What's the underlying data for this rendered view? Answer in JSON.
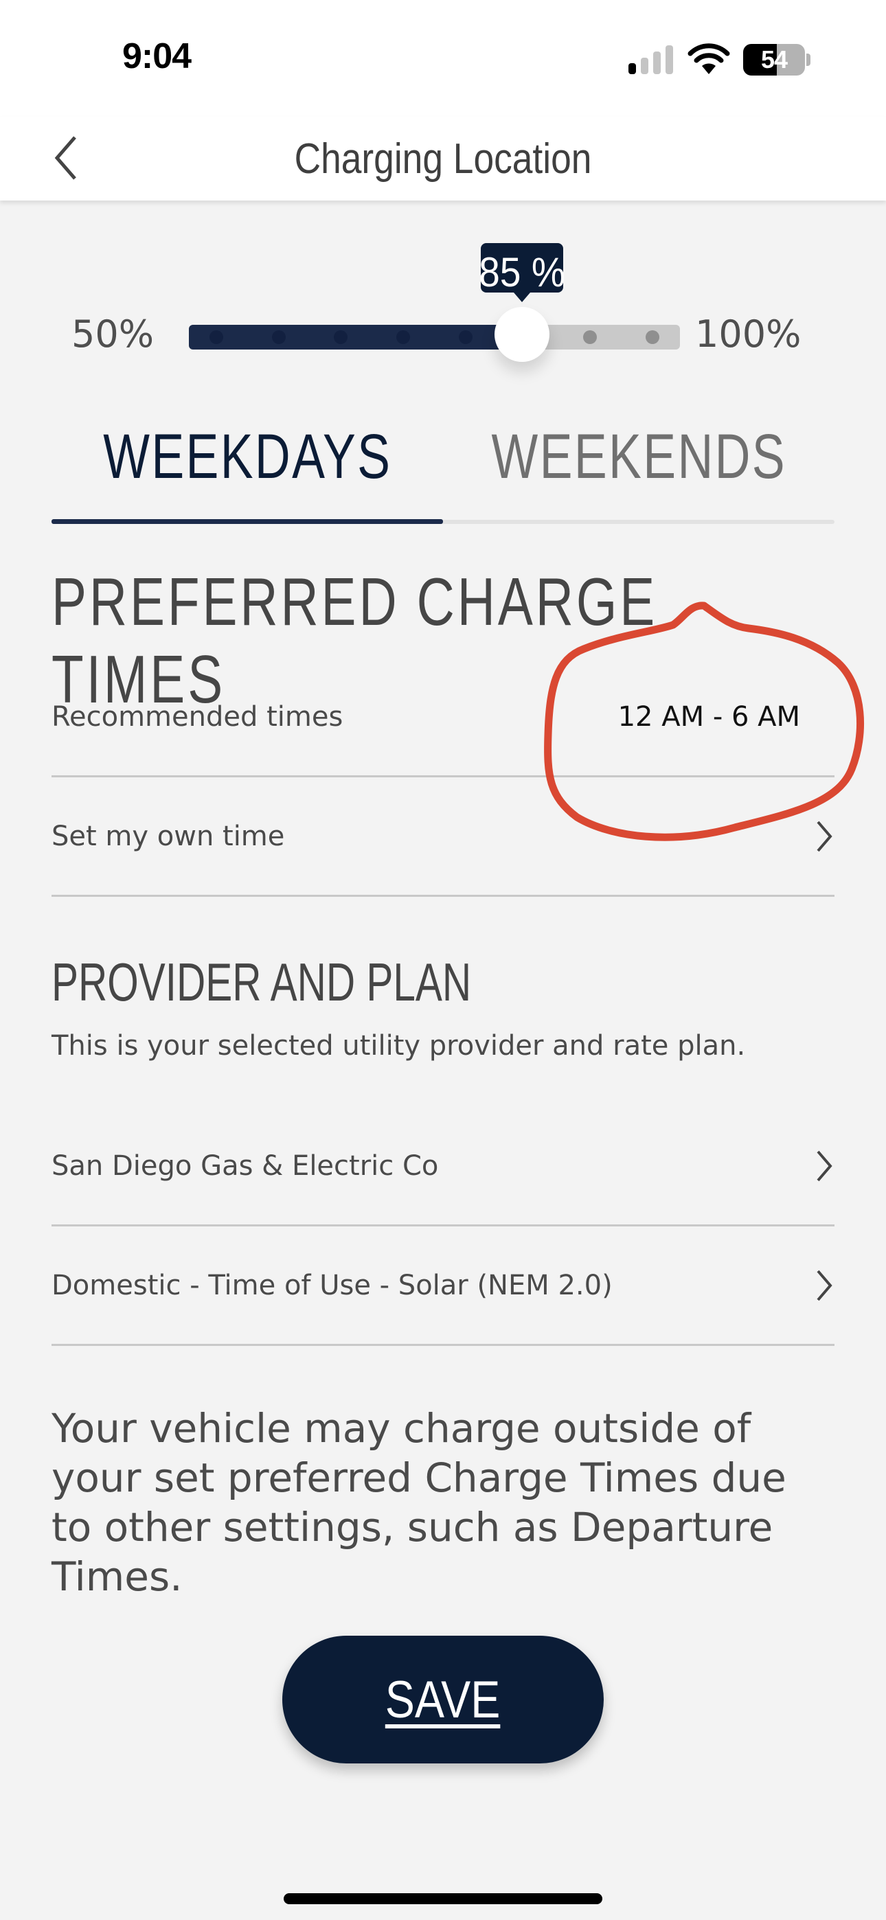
{
  "status_bar": {
    "time": "9:04",
    "battery_level": 54,
    "battery_text": "54",
    "signal_bars_active": 1,
    "signal_bars_total": 4,
    "icons": [
      "cellular-signal-icon",
      "wifi-icon",
      "battery-icon"
    ]
  },
  "header": {
    "title": "Charging Location",
    "back_icon": "chevron-left-icon"
  },
  "charge_limit_slider": {
    "min_label": "50%",
    "max_label": "100%",
    "min_value": 50,
    "max_value": 100,
    "value": 85,
    "value_label": "85 %",
    "step_dots": 8,
    "colors": {
      "fill": "#1b2a4a",
      "track": "#c9c9c9",
      "dot_active": "#122040",
      "dot_inactive": "#8f8f8f",
      "tooltip": "#0b1c36"
    }
  },
  "tabs": {
    "items": [
      {
        "label": "WEEKDAYS",
        "active": true
      },
      {
        "label": "WEEKENDS",
        "active": false
      }
    ]
  },
  "preferred_charge_times": {
    "heading": "PREFERRED CHARGE TIMES",
    "rows": [
      {
        "label": "Recommended times",
        "value": "12 AM - 6 AM"
      },
      {
        "label": "Set my own time",
        "icon": "chevron-right-icon"
      }
    ]
  },
  "provider_and_plan": {
    "heading": "PROVIDER AND PLAN",
    "description": "This is your selected utility provider and rate plan.",
    "rows": [
      {
        "label": "San Diego Gas & Electric Co",
        "icon": "chevron-right-icon"
      },
      {
        "label": "Domestic - Time of Use - Solar (NEM 2.0)",
        "icon": "chevron-right-icon"
      }
    ]
  },
  "disclaimer": "Your vehicle may charge outside of your set preferred Charge Times due to other settings, such as Departure Times.",
  "save_button": {
    "label": "SAVE"
  },
  "annotation": {
    "type": "hand-drawn-circle",
    "color": "#d83a22",
    "target": "Recommended times value"
  },
  "theme": {
    "background": "#f3f3f3",
    "header_bg": "#ffffff",
    "primary_navy": "#0b1c36",
    "text_gray": "#4a4a4a",
    "inactive_tab": "#707070",
    "divider": "#c8c8c8"
  }
}
